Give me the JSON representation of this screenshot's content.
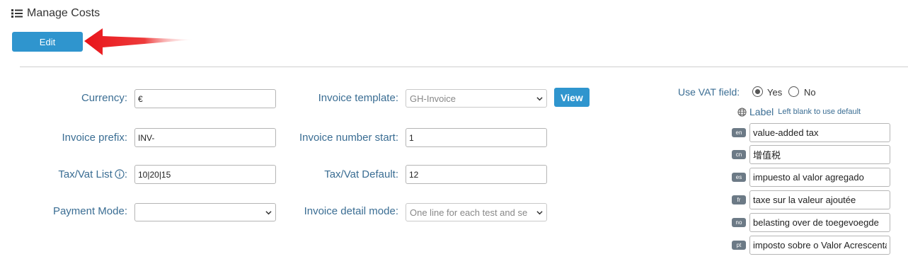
{
  "header": {
    "title": "Manage Costs",
    "icon": "list-icon"
  },
  "toolbar": {
    "edit_label": "Edit",
    "accent": "#2f95ce",
    "arrow_color": "#e8141a"
  },
  "form": {
    "currency": {
      "label": "Currency:",
      "value": "€"
    },
    "invoice_prefix": {
      "label": "Invoice prefix:",
      "value": "INV-"
    },
    "tax_vat_list": {
      "label": "Tax/Vat List",
      "label_suffix": ":",
      "value": "10|20|15",
      "icon": "info-icon"
    },
    "payment_mode": {
      "label": "Payment Mode:",
      "value": ""
    },
    "invoice_template": {
      "label": "Invoice template:",
      "value": "GH-Invoice",
      "view_label": "View"
    },
    "invoice_number_start": {
      "label": "Invoice number start:",
      "value": "1"
    },
    "tax_vat_default": {
      "label": "Tax/Vat Default:",
      "value": "12"
    },
    "invoice_detail_mode": {
      "label": "Invoice detail mode:",
      "value": "One line for each test and se"
    }
  },
  "vat": {
    "label": "Use VAT field:",
    "options": [
      {
        "label": "Yes",
        "checked": true
      },
      {
        "label": "No",
        "checked": false
      }
    ],
    "label_title": "Label",
    "label_hint": "Left blank to use default",
    "translations": [
      {
        "lang": "en",
        "value": "value-added tax"
      },
      {
        "lang": "cn",
        "value": "增值税"
      },
      {
        "lang": "es",
        "value": "impuesto al valor agregado"
      },
      {
        "lang": "fr",
        "value": "taxe sur la valeur ajoutée"
      },
      {
        "lang": "no",
        "value": "belasting over de toegevoegde"
      },
      {
        "lang": "pt",
        "value": "imposto sobre o Valor Acrescentado"
      }
    ]
  }
}
